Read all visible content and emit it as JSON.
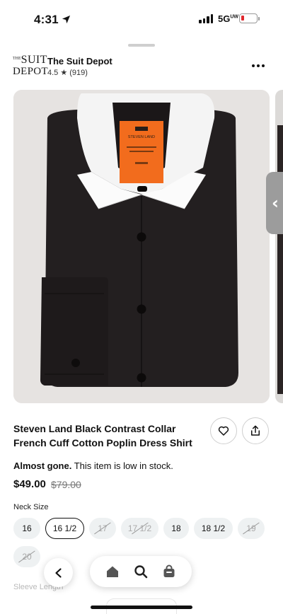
{
  "status_bar": {
    "time": "4:31",
    "network": "5G",
    "network_suffix": "UW",
    "icons": [
      "location-arrow-icon",
      "signal-icon",
      "battery-low-icon"
    ],
    "battery_color": "#e0282d"
  },
  "store": {
    "logo_line1": "SUIT",
    "logo_prefix": "THE",
    "logo_line2": "DEPOT",
    "name": "The Suit Depot",
    "rating": "4.5 ★ (919)"
  },
  "product": {
    "label_brand": "STEVEN LAND",
    "title": "Steven Land Black Contrast Collar French Cuff Cotton Poplin Dress Shirt",
    "stock_emphasis": "Almost gone.",
    "stock_text": " This item is low in stock.",
    "price": "$49.00",
    "compare_price": "$79.00"
  },
  "options": {
    "neck_label": "Neck Size",
    "sizes": [
      {
        "label": "16",
        "state": "available"
      },
      {
        "label": "16 1/2",
        "state": "selected"
      },
      {
        "label": "17",
        "state": "unavailable"
      },
      {
        "label": "17 1/2",
        "state": "unavailable"
      },
      {
        "label": "18",
        "state": "available"
      },
      {
        "label": "18 1/2",
        "state": "available"
      },
      {
        "label": "19",
        "state": "unavailable"
      },
      {
        "label": "20",
        "state": "unavailable"
      }
    ],
    "sleeve_label": "Sleeve Length"
  },
  "navigation": {
    "icons": [
      "back-chevron-icon",
      "home-icon",
      "search-icon",
      "shop-bag-icon"
    ]
  },
  "colors": {
    "accent_orange": "#f26c1d",
    "shirt_black": "#231f20",
    "chip_bg": "#eef1f2"
  }
}
